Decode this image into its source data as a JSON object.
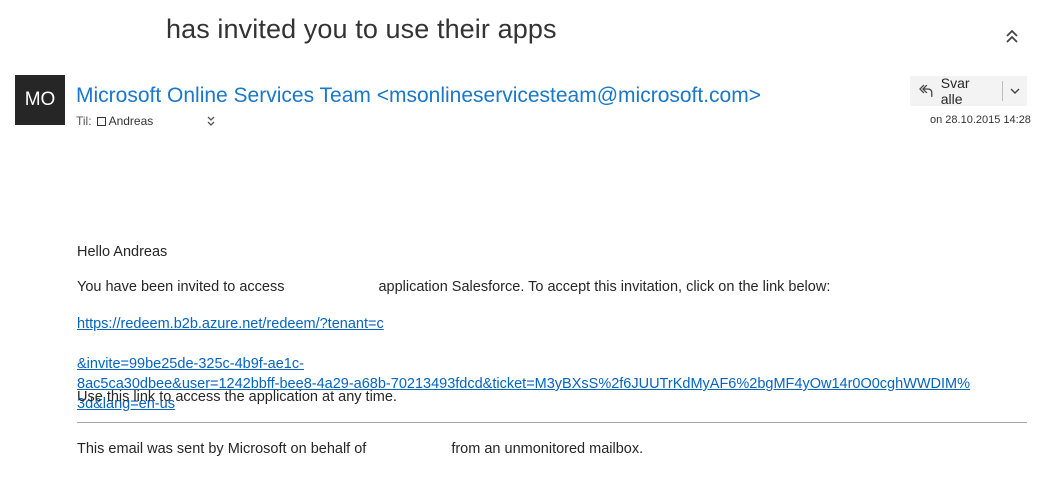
{
  "subject": "has invited you to use their apps",
  "header": {
    "avatar_initials": "MO",
    "sender": "Microsoft Online Services Team <msonlineservicesteam@microsoft.com>",
    "to_label": "Til:",
    "recipient": "Andreas",
    "date": "on 28.10.2015 14:28",
    "reply_all_label": "Svar alle"
  },
  "body": {
    "greeting": "Hello Andreas",
    "invite_before": "You have been invited to access",
    "invite_after": "application Salesforce. To accept this invitation, click on the link below:",
    "link_line1_a": "https://redeem.b2b.azure.net/redeem/?tenant=c",
    "link_line1_b": "&invite=99be25de-325c-4b9f-ae1c-",
    "link_line2": "8ac5ca30dbee&user=1242bbff-bee8-4a29-a68b-70213493fdcd&ticket=M3yBXsS%2f6JUUTrKdMyAF6%2bgMF4yOw14r0O0cghWWDIM%",
    "link_line3": "3d&lang=en-us",
    "use_link_text": "Use this link to access the application at any time.",
    "footer_before": "This email was sent by Microsoft on behalf of",
    "footer_after": "from an unmonitored mailbox."
  },
  "icons": {
    "collapse": "double-chevron-up-icon",
    "reply_all": "reply-all-icon",
    "dropdown": "chevron-down-icon",
    "expand_recipients": "double-chevron-down-icon"
  },
  "colors": {
    "sender_link": "#1a77c9",
    "body_link": "#0563c1",
    "avatar_bg": "#262626",
    "button_bg": "#f3f3f3"
  }
}
